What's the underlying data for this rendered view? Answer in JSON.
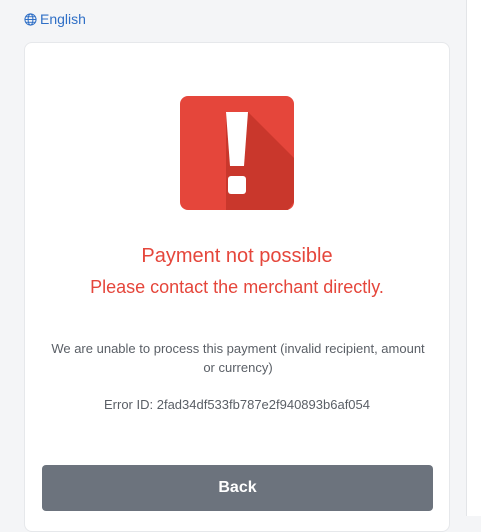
{
  "language": {
    "icon": "globe-icon",
    "label": "English"
  },
  "alert": {
    "icon": "exclamation-icon",
    "color": "#e5463b",
    "shadow_color": "#bf3328",
    "title": "Payment not possible",
    "subtitle": "Please contact the merchant directly.",
    "message": "We are unable to process this payment (invalid recipient, amount or currency)",
    "error_id": "Error ID: 2fad34df533fb787e2f940893b6af054"
  },
  "actions": {
    "back_label": "Back",
    "back_color": "#6c737d"
  }
}
